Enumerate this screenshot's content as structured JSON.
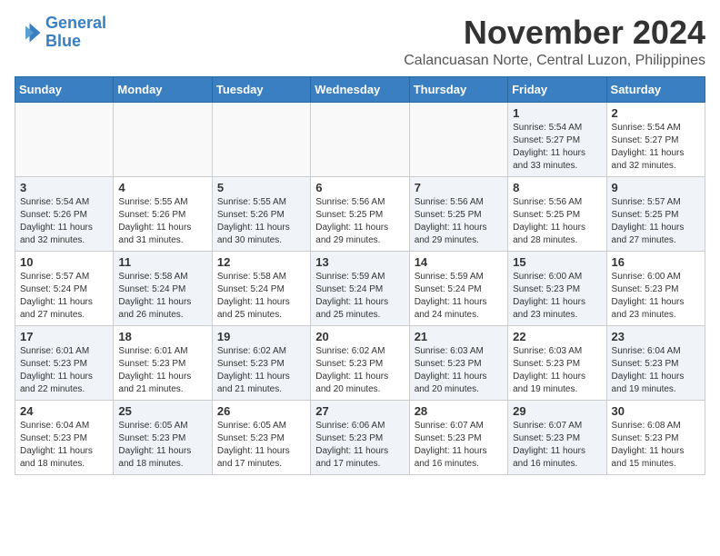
{
  "header": {
    "logo_line1": "General",
    "logo_line2": "Blue",
    "month_title": "November 2024",
    "location": "Calancuasan Norte, Central Luzon, Philippines"
  },
  "weekdays": [
    "Sunday",
    "Monday",
    "Tuesday",
    "Wednesday",
    "Thursday",
    "Friday",
    "Saturday"
  ],
  "weeks": [
    [
      {
        "day": "",
        "sunrise": "",
        "sunset": "",
        "daylight": "",
        "empty": true
      },
      {
        "day": "",
        "sunrise": "",
        "sunset": "",
        "daylight": "",
        "empty": true
      },
      {
        "day": "",
        "sunrise": "",
        "sunset": "",
        "daylight": "",
        "empty": true
      },
      {
        "day": "",
        "sunrise": "",
        "sunset": "",
        "daylight": "",
        "empty": true
      },
      {
        "day": "",
        "sunrise": "",
        "sunset": "",
        "daylight": "",
        "empty": true
      },
      {
        "day": "1",
        "sunrise": "Sunrise: 5:54 AM",
        "sunset": "Sunset: 5:27 PM",
        "daylight": "Daylight: 11 hours and 33 minutes.",
        "empty": false,
        "shaded": true
      },
      {
        "day": "2",
        "sunrise": "Sunrise: 5:54 AM",
        "sunset": "Sunset: 5:27 PM",
        "daylight": "Daylight: 11 hours and 32 minutes.",
        "empty": false,
        "shaded": false
      }
    ],
    [
      {
        "day": "3",
        "sunrise": "Sunrise: 5:54 AM",
        "sunset": "Sunset: 5:26 PM",
        "daylight": "Daylight: 11 hours and 32 minutes.",
        "empty": false,
        "shaded": true
      },
      {
        "day": "4",
        "sunrise": "Sunrise: 5:55 AM",
        "sunset": "Sunset: 5:26 PM",
        "daylight": "Daylight: 11 hours and 31 minutes.",
        "empty": false,
        "shaded": false
      },
      {
        "day": "5",
        "sunrise": "Sunrise: 5:55 AM",
        "sunset": "Sunset: 5:26 PM",
        "daylight": "Daylight: 11 hours and 30 minutes.",
        "empty": false,
        "shaded": true
      },
      {
        "day": "6",
        "sunrise": "Sunrise: 5:56 AM",
        "sunset": "Sunset: 5:25 PM",
        "daylight": "Daylight: 11 hours and 29 minutes.",
        "empty": false,
        "shaded": false
      },
      {
        "day": "7",
        "sunrise": "Sunrise: 5:56 AM",
        "sunset": "Sunset: 5:25 PM",
        "daylight": "Daylight: 11 hours and 29 minutes.",
        "empty": false,
        "shaded": true
      },
      {
        "day": "8",
        "sunrise": "Sunrise: 5:56 AM",
        "sunset": "Sunset: 5:25 PM",
        "daylight": "Daylight: 11 hours and 28 minutes.",
        "empty": false,
        "shaded": false
      },
      {
        "day": "9",
        "sunrise": "Sunrise: 5:57 AM",
        "sunset": "Sunset: 5:25 PM",
        "daylight": "Daylight: 11 hours and 27 minutes.",
        "empty": false,
        "shaded": true
      }
    ],
    [
      {
        "day": "10",
        "sunrise": "Sunrise: 5:57 AM",
        "sunset": "Sunset: 5:24 PM",
        "daylight": "Daylight: 11 hours and 27 minutes.",
        "empty": false,
        "shaded": false
      },
      {
        "day": "11",
        "sunrise": "Sunrise: 5:58 AM",
        "sunset": "Sunset: 5:24 PM",
        "daylight": "Daylight: 11 hours and 26 minutes.",
        "empty": false,
        "shaded": true
      },
      {
        "day": "12",
        "sunrise": "Sunrise: 5:58 AM",
        "sunset": "Sunset: 5:24 PM",
        "daylight": "Daylight: 11 hours and 25 minutes.",
        "empty": false,
        "shaded": false
      },
      {
        "day": "13",
        "sunrise": "Sunrise: 5:59 AM",
        "sunset": "Sunset: 5:24 PM",
        "daylight": "Daylight: 11 hours and 25 minutes.",
        "empty": false,
        "shaded": true
      },
      {
        "day": "14",
        "sunrise": "Sunrise: 5:59 AM",
        "sunset": "Sunset: 5:24 PM",
        "daylight": "Daylight: 11 hours and 24 minutes.",
        "empty": false,
        "shaded": false
      },
      {
        "day": "15",
        "sunrise": "Sunrise: 6:00 AM",
        "sunset": "Sunset: 5:23 PM",
        "daylight": "Daylight: 11 hours and 23 minutes.",
        "empty": false,
        "shaded": true
      },
      {
        "day": "16",
        "sunrise": "Sunrise: 6:00 AM",
        "sunset": "Sunset: 5:23 PM",
        "daylight": "Daylight: 11 hours and 23 minutes.",
        "empty": false,
        "shaded": false
      }
    ],
    [
      {
        "day": "17",
        "sunrise": "Sunrise: 6:01 AM",
        "sunset": "Sunset: 5:23 PM",
        "daylight": "Daylight: 11 hours and 22 minutes.",
        "empty": false,
        "shaded": true
      },
      {
        "day": "18",
        "sunrise": "Sunrise: 6:01 AM",
        "sunset": "Sunset: 5:23 PM",
        "daylight": "Daylight: 11 hours and 21 minutes.",
        "empty": false,
        "shaded": false
      },
      {
        "day": "19",
        "sunrise": "Sunrise: 6:02 AM",
        "sunset": "Sunset: 5:23 PM",
        "daylight": "Daylight: 11 hours and 21 minutes.",
        "empty": false,
        "shaded": true
      },
      {
        "day": "20",
        "sunrise": "Sunrise: 6:02 AM",
        "sunset": "Sunset: 5:23 PM",
        "daylight": "Daylight: 11 hours and 20 minutes.",
        "empty": false,
        "shaded": false
      },
      {
        "day": "21",
        "sunrise": "Sunrise: 6:03 AM",
        "sunset": "Sunset: 5:23 PM",
        "daylight": "Daylight: 11 hours and 20 minutes.",
        "empty": false,
        "shaded": true
      },
      {
        "day": "22",
        "sunrise": "Sunrise: 6:03 AM",
        "sunset": "Sunset: 5:23 PM",
        "daylight": "Daylight: 11 hours and 19 minutes.",
        "empty": false,
        "shaded": false
      },
      {
        "day": "23",
        "sunrise": "Sunrise: 6:04 AM",
        "sunset": "Sunset: 5:23 PM",
        "daylight": "Daylight: 11 hours and 19 minutes.",
        "empty": false,
        "shaded": true
      }
    ],
    [
      {
        "day": "24",
        "sunrise": "Sunrise: 6:04 AM",
        "sunset": "Sunset: 5:23 PM",
        "daylight": "Daylight: 11 hours and 18 minutes.",
        "empty": false,
        "shaded": false
      },
      {
        "day": "25",
        "sunrise": "Sunrise: 6:05 AM",
        "sunset": "Sunset: 5:23 PM",
        "daylight": "Daylight: 11 hours and 18 minutes.",
        "empty": false,
        "shaded": true
      },
      {
        "day": "26",
        "sunrise": "Sunrise: 6:05 AM",
        "sunset": "Sunset: 5:23 PM",
        "daylight": "Daylight: 11 hours and 17 minutes.",
        "empty": false,
        "shaded": false
      },
      {
        "day": "27",
        "sunrise": "Sunrise: 6:06 AM",
        "sunset": "Sunset: 5:23 PM",
        "daylight": "Daylight: 11 hours and 17 minutes.",
        "empty": false,
        "shaded": true
      },
      {
        "day": "28",
        "sunrise": "Sunrise: 6:07 AM",
        "sunset": "Sunset: 5:23 PM",
        "daylight": "Daylight: 11 hours and 16 minutes.",
        "empty": false,
        "shaded": false
      },
      {
        "day": "29",
        "sunrise": "Sunrise: 6:07 AM",
        "sunset": "Sunset: 5:23 PM",
        "daylight": "Daylight: 11 hours and 16 minutes.",
        "empty": false,
        "shaded": true
      },
      {
        "day": "30",
        "sunrise": "Sunrise: 6:08 AM",
        "sunset": "Sunset: 5:23 PM",
        "daylight": "Daylight: 11 hours and 15 minutes.",
        "empty": false,
        "shaded": false
      }
    ]
  ]
}
